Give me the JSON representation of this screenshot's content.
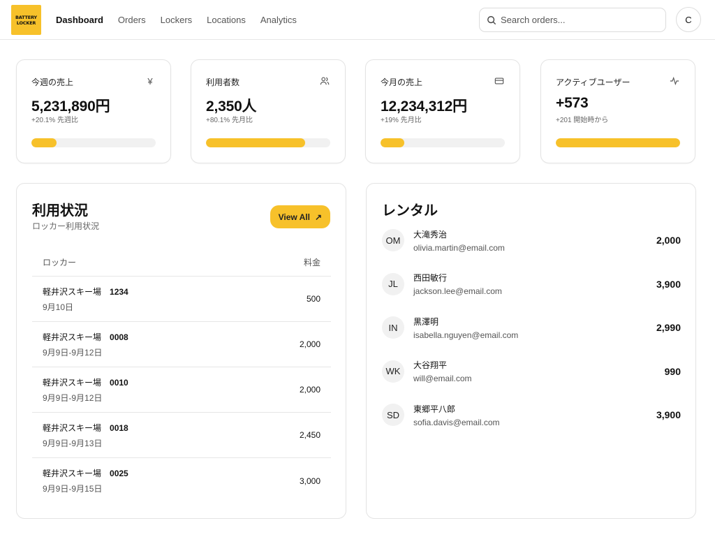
{
  "header": {
    "logo_line1": "BATTERY",
    "logo_line2": "LOCKER",
    "nav": [
      "Dashboard",
      "Orders",
      "Lockers",
      "Locations",
      "Analytics"
    ],
    "search_placeholder": "Search orders...",
    "avatar_initial": "C",
    "brand_color": "#f7c12a"
  },
  "stats": [
    {
      "title": "今週の売上",
      "icon": "yen-icon",
      "value": "5,231,890円",
      "sub": "+20.1% 先週比",
      "progress_percent": 20
    },
    {
      "title": "利用者数",
      "icon": "users-icon",
      "value": "2,350人",
      "sub": "+80.1% 先月比",
      "progress_percent": 80
    },
    {
      "title": "今月の売上",
      "icon": "credit-card-icon",
      "value": "12,234,312円",
      "sub": "+19% 先月比",
      "progress_percent": 19
    },
    {
      "title": "アクティブユーザー",
      "icon": "activity-icon",
      "value": "+573",
      "sub": "+201 開始時から",
      "progress_percent": 100
    }
  ],
  "usage": {
    "title": "利用状況",
    "subtitle": "ロッカー利用状況",
    "view_all": "View All",
    "col_locker": "ロッカー",
    "col_fee": "料金",
    "rows": [
      {
        "location": "軽井沢スキー場",
        "code": "1234",
        "date": "9月10日",
        "amount": "500"
      },
      {
        "location": "軽井沢スキー場",
        "code": "0008",
        "date": "9月9日-9月12日",
        "amount": "2,000"
      },
      {
        "location": "軽井沢スキー場",
        "code": "0010",
        "date": "9月9日-9月12日",
        "amount": "2,000"
      },
      {
        "location": "軽井沢スキー場",
        "code": "0018",
        "date": "9月9日-9月13日",
        "amount": "2,450"
      },
      {
        "location": "軽井沢スキー場",
        "code": "0025",
        "date": "9月9日-9月15日",
        "amount": "3,000"
      }
    ]
  },
  "rentals": {
    "title": "レンタル",
    "items": [
      {
        "initials": "OM",
        "name": "大滝秀治",
        "email": "olivia.martin@email.com",
        "amount": "2,000"
      },
      {
        "initials": "JL",
        "name": "西田敏行",
        "email": "jackson.lee@email.com",
        "amount": "3,900"
      },
      {
        "initials": "IN",
        "name": "黒澤明",
        "email": "isabella.nguyen@email.com",
        "amount": "2,990"
      },
      {
        "initials": "WK",
        "name": "大谷翔平",
        "email": "will@email.com",
        "amount": "990"
      },
      {
        "initials": "SD",
        "name": "東郷平八郎",
        "email": "sofia.davis@email.com",
        "amount": "3,900"
      }
    ]
  }
}
